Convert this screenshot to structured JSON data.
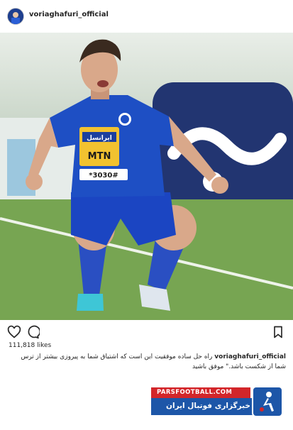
{
  "post": {
    "username": "voriaghafuri_official",
    "likes": "111,818 likes",
    "caption_user": "voriaghafuri_official",
    "caption_text": "راه حل ساده موفقیت این است که اشتیاق شما به پیروزی بیشتر از ترس شما از شکست باشد.\" موفق باشید"
  },
  "jersey": {
    "sponsor": "ایرانسل",
    "brand": "MTN",
    "code": "*3030#"
  },
  "branding": {
    "site": "PARSFOOTBALL.COM",
    "tagline": "خبرگزاری فوتبال ایران"
  },
  "colors": {
    "kit_blue": "#1e4fc4",
    "brand_red": "#d3262a",
    "brand_blue": "#1d56a8"
  },
  "icons": [
    "heart-icon",
    "comment-icon",
    "bookmark-icon"
  ]
}
